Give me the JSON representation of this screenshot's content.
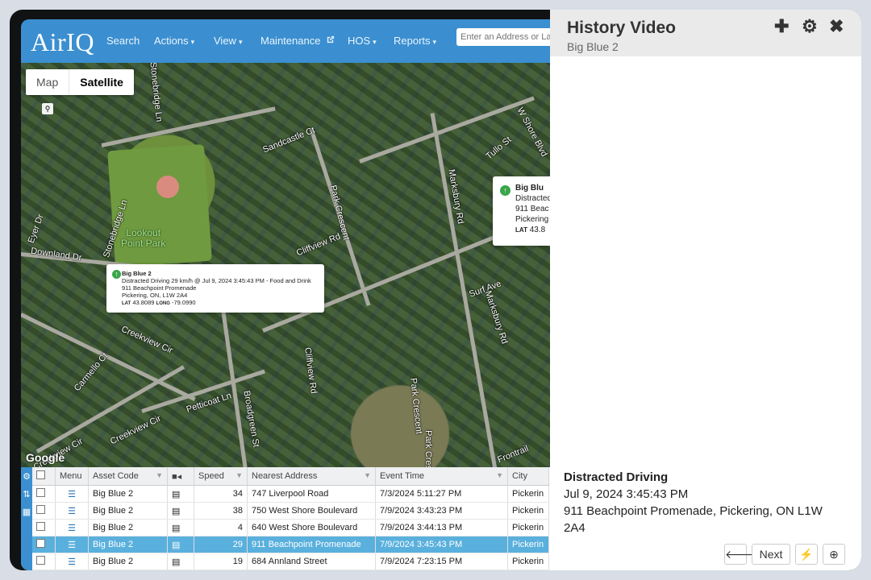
{
  "app": {
    "logo": "AirIQ",
    "nav": [
      {
        "label": "Search"
      },
      {
        "label": "Actions",
        "caret": "▾"
      },
      {
        "label": "View",
        "caret": "▾"
      },
      {
        "label": "Maintenance",
        "icon": "external-link-icon"
      },
      {
        "label": "HOS",
        "caret": "▾"
      },
      {
        "label": "Reports",
        "caret": "▾"
      }
    ],
    "address_placeholder": "Enter an Address or La",
    "brand_color": "#3b8fd0"
  },
  "map": {
    "toggle": {
      "map": "Map",
      "satellite": "Satellite",
      "selected": "Satellite"
    },
    "google": "Google",
    "park_label": "Lookout\nPoint Park",
    "streets": [
      "Stonebridge Ln",
      "Sandcastle Ct",
      "Tullo St",
      "W Shore Blvd",
      "Marksbury Rd",
      "Park Crescent",
      "Cliffview Rd",
      "Downland Dr",
      "Eyer Dr",
      "Stonebridge Ln",
      "Surf Ave",
      "Marksbury Rd",
      "Creekview Cir",
      "Carmello Ct",
      "Petticoat Ln",
      "Broadgreen St",
      "Cliffview Rd",
      "Park Crescent",
      "Creekview Cir",
      "Creekview Cir",
      "Frontrail",
      "Park Crescent"
    ],
    "popup1": {
      "name": "Big Blue 2",
      "event": "Distracted Driving 29 km/h @ Jul 9, 2024 3:45:43 PM - Food and Drink",
      "addr1": "911 Beachpoint Promenade",
      "addr2": "Pickering, ON, L1W 2A4",
      "lat_label": "LAT",
      "lat": "43.8089",
      "long_label": "LONG",
      "long": "-79.0990"
    },
    "popup2": {
      "name": "Big Blu",
      "line1": "Distracted",
      "line2": "911 Beac",
      "line3": "Pickering",
      "lat_label": "LAT",
      "lat": "43.8"
    }
  },
  "grid": {
    "columns": [
      "Menu",
      "Asset Code",
      "Speed",
      "Nearest Address",
      "Event Time",
      "City"
    ],
    "rows": [
      {
        "asset": "Big Blue 2",
        "speed": "34",
        "address": "747 Liverpool Road",
        "time": "7/3/2024 5:11:27 PM",
        "city": "Pickerin"
      },
      {
        "asset": "Big Blue 2",
        "speed": "38",
        "address": "750 West Shore Boulevard",
        "time": "7/9/2024 3:43:23 PM",
        "city": "Pickerin"
      },
      {
        "asset": "Big Blue 2",
        "speed": "4",
        "address": "640 West Shore Boulevard",
        "time": "7/9/2024 3:44:13 PM",
        "city": "Pickerin"
      },
      {
        "asset": "Big Blue 2",
        "speed": "29",
        "address": "911 Beachpoint Promenade",
        "time": "7/9/2024 3:45:43 PM",
        "city": "Pickerin",
        "selected": true
      },
      {
        "asset": "Big Blue 2",
        "speed": "19",
        "address": "684 Annland Street",
        "time": "7/9/2024 7:23:15 PM",
        "city": "Pickerin"
      }
    ],
    "selected_color": "#5ab0dd"
  },
  "panel": {
    "title": "History Video",
    "subtitle": "Big Blue 2",
    "event_type": "Distracted Driving",
    "event_time": "Jul 9, 2024 3:45:43 PM",
    "event_address": "911 Beachpoint Promenade, Pickering, ON L1W 2A4",
    "buttons": {
      "prev": "🡐",
      "next": "Next",
      "flash": "⚡",
      "target": "⊕"
    }
  }
}
